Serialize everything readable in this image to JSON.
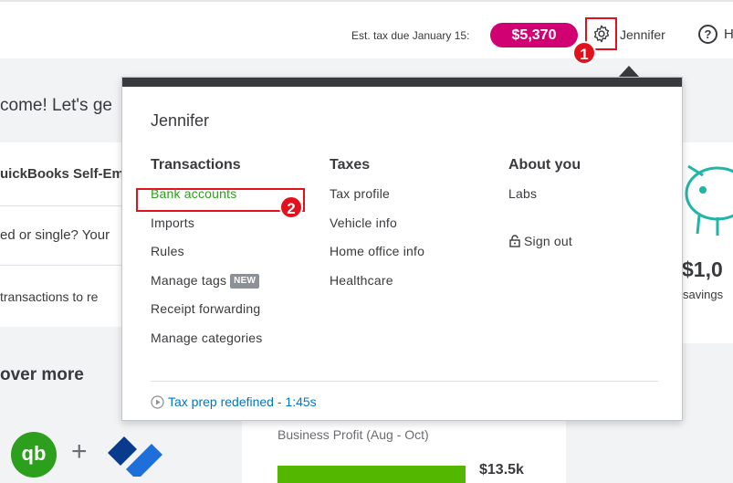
{
  "header": {
    "tax_label": "Est. tax due January 15:",
    "tax_amount": "$5,370",
    "user_name": "Jennifer",
    "help_label": "H",
    "accent_color": "#d10073"
  },
  "annotations": {
    "badge_1": "1",
    "badge_2": "2"
  },
  "background": {
    "welcome": "come! Let's ge",
    "left_rows": [
      "uickBooks Self-Em",
      "ed or single? Your",
      "transactions to re"
    ],
    "discover": "over more",
    "qb_logo": "qb",
    "plus": "+",
    "savings_amount": "$1,0",
    "savings_label": "savings",
    "profit_title": "Business Profit (Aug - Oct)",
    "profit_amount": "$13.5k"
  },
  "dropdown": {
    "user": "Jennifer",
    "columns": [
      {
        "heading": "Transactions",
        "items": [
          "Bank accounts",
          "Imports",
          "Rules",
          "Manage tags",
          "Receipt forwarding",
          "Manage categories"
        ]
      },
      {
        "heading": "Taxes",
        "items": [
          "Tax profile",
          "Vehicle info",
          "Home office info",
          "Healthcare"
        ]
      },
      {
        "heading": "About you",
        "items": [
          "Labs",
          "Sign out"
        ]
      }
    ],
    "new_tag": "NEW",
    "footer_link": "Tax prep redefined - 1:45s"
  }
}
